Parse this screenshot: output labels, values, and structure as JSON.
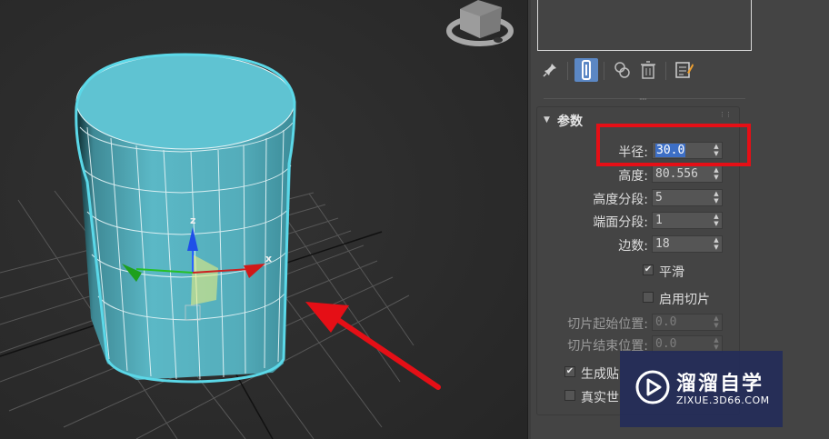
{
  "rollout": {
    "title": "参数",
    "params": [
      {
        "label": "半径:",
        "value": "30.0",
        "selected": true,
        "enabled": true
      },
      {
        "label": "高度:",
        "value": "80.556",
        "selected": false,
        "enabled": true
      },
      {
        "label": "高度分段:",
        "value": "5",
        "selected": false,
        "enabled": true
      },
      {
        "label": "端面分段:",
        "value": "1",
        "selected": false,
        "enabled": true
      },
      {
        "label": "边数:",
        "value": "18",
        "selected": false,
        "enabled": true
      }
    ],
    "smooth": {
      "label": "平滑",
      "checked": true
    },
    "slice_on": {
      "label": "启用切片",
      "checked": false
    },
    "slice_params": [
      {
        "label": "切片起始位置:",
        "value": "0.0",
        "enabled": false
      },
      {
        "label": "切片结束位置:",
        "value": "0.0",
        "enabled": false
      }
    ],
    "gen_mapping": {
      "label": "生成贴",
      "checked": true
    },
    "real_world": {
      "label": "真实世",
      "checked": false
    }
  },
  "toolbar": {
    "icons": [
      "pin-stack-icon",
      "modifier-stack-toggle-icon",
      "make-unique-icon",
      "remove-modifier-icon",
      "configure-modifier-sets-icon"
    ]
  },
  "gizmo": {
    "x_label": "x",
    "z_label": "z"
  },
  "watermark": {
    "title": "溜溜自学",
    "subtitle": "ZIXUE.3D66.COM"
  },
  "colors": {
    "annotation_red": "#e50f16",
    "selection_cyan": "#5bd8e8",
    "cylinder_fill": "#5fbfcf",
    "panel_bg": "#444444",
    "viewport_bg": "#2a2a2a"
  }
}
